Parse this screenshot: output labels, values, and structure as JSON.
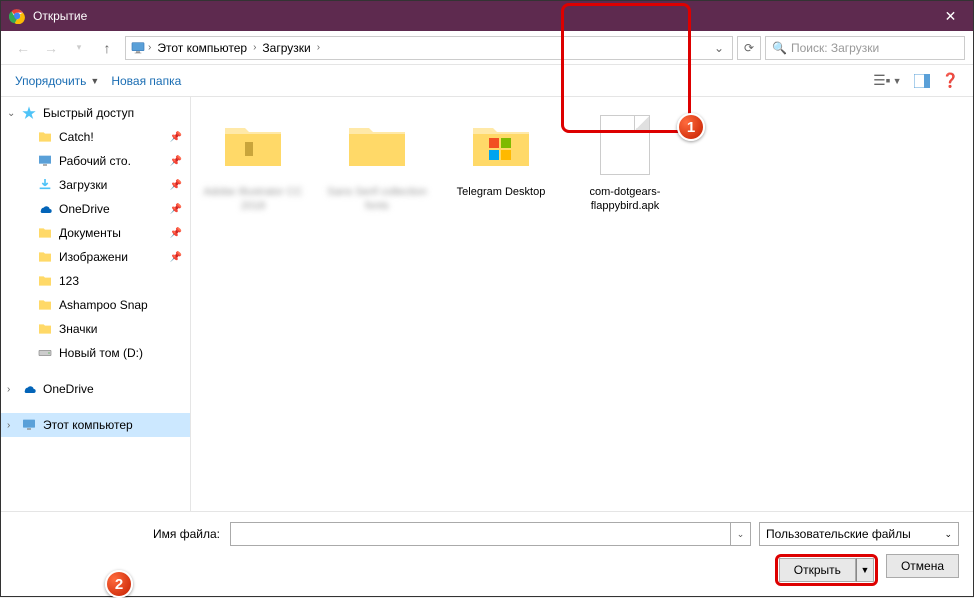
{
  "titlebar": {
    "title": "Открытие"
  },
  "nav": {
    "breadcrumb": [
      "Этот компьютер",
      "Загрузки"
    ],
    "search_placeholder": "Поиск: Загрузки"
  },
  "toolbar": {
    "organize": "Упорядочить",
    "newfolder": "Новая папка"
  },
  "sidebar": {
    "quick": "Быстрый доступ",
    "items": [
      {
        "label": "Catch!",
        "icon": "folder",
        "pinned": true
      },
      {
        "label": "Рабочий сто.",
        "icon": "desktop",
        "pinned": true
      },
      {
        "label": "Загрузки",
        "icon": "download",
        "pinned": true
      },
      {
        "label": "OneDrive",
        "icon": "onedrive",
        "pinned": true
      },
      {
        "label": "Документы",
        "icon": "folder",
        "pinned": true
      },
      {
        "label": "Изображени",
        "icon": "folder",
        "pinned": true
      },
      {
        "label": "123",
        "icon": "folder",
        "pinned": false
      },
      {
        "label": "Ashampoo Snap",
        "icon": "folder",
        "pinned": false
      },
      {
        "label": "Значки",
        "icon": "folder",
        "pinned": false
      },
      {
        "label": "Новый том (D:)",
        "icon": "drive",
        "pinned": false
      }
    ],
    "onedrive": "OneDrive",
    "thispc": "Этот компьютер"
  },
  "files": [
    {
      "label": "Adobe Illustrator CC 2018",
      "type": "folder",
      "blurred": true
    },
    {
      "label": "Sans Serif collection fonts",
      "type": "folder",
      "blurred": true
    },
    {
      "label": "Telegram Desktop",
      "type": "folder-telegram",
      "blurred": false
    },
    {
      "label": "com-dotgears-flappybird.apk",
      "type": "file",
      "blurred": false,
      "selected": true
    }
  ],
  "bottom": {
    "filename_label": "Имя файла:",
    "filename_value": "",
    "filetype": "Пользовательские файлы",
    "open": "Открыть",
    "cancel": "Отмена"
  },
  "badges": {
    "b1": "1",
    "b2": "2"
  }
}
